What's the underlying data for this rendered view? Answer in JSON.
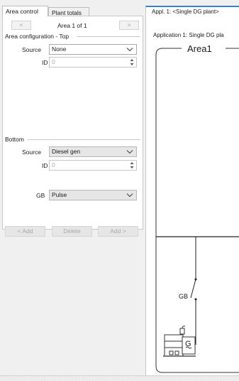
{
  "left_tabs": [
    "Area control",
    "Plant totals"
  ],
  "navigator": {
    "prev": "<",
    "label": "Area 1 of 1",
    "next": ">"
  },
  "top_section": {
    "title": "Area configuration - Top",
    "source_label": "Source",
    "source_value": "None",
    "id_label": "ID",
    "id_value": "0"
  },
  "bottom_section": {
    "title": "Bottom",
    "source_label": "Source",
    "source_value": "Diesel gen",
    "id_label": "ID",
    "id_value": "0",
    "gb_label": "GB",
    "gb_value": "Pulse"
  },
  "actions": {
    "add_prev": "< Add",
    "delete": "Delete",
    "add_next": "Add >"
  },
  "document": {
    "tab": "Appl. 1: <Single DG plant>",
    "app_title": "Application 1: Single DG pla",
    "area_title": "Area1",
    "breaker_label": "GB",
    "generator_symbol": "G",
    "accent_color": "#3a7fd0"
  }
}
